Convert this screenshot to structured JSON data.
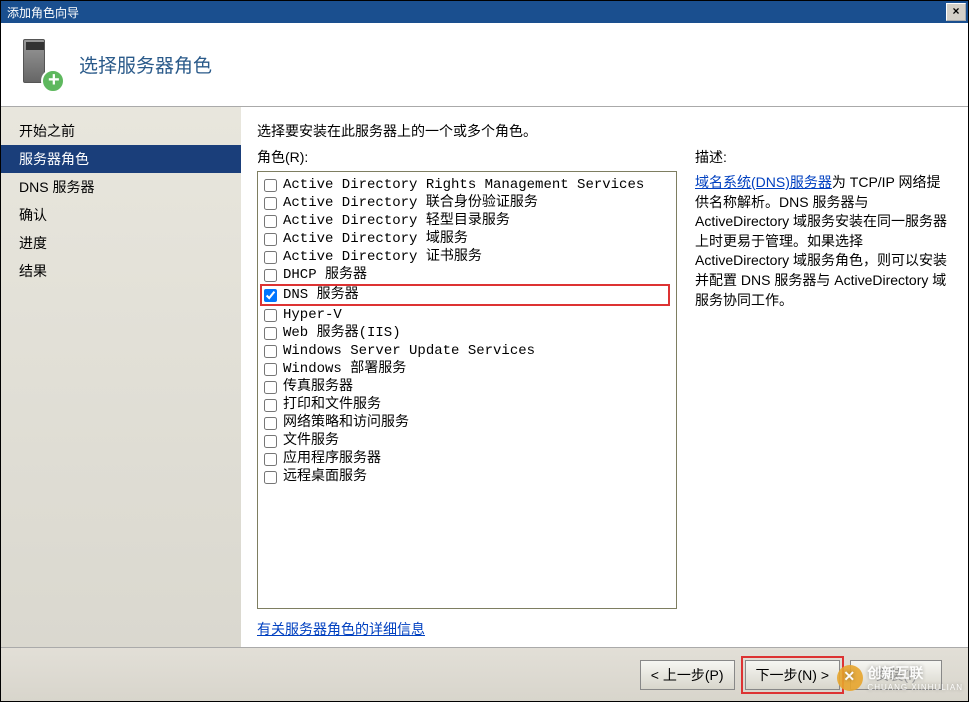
{
  "titlebar": {
    "title": "添加角色向导",
    "close": "×"
  },
  "header": {
    "title": "选择服务器角色"
  },
  "sidebar": {
    "items": [
      {
        "label": "开始之前",
        "selected": false
      },
      {
        "label": "服务器角色",
        "selected": true
      },
      {
        "label": "DNS 服务器",
        "selected": false
      },
      {
        "label": "确认",
        "selected": false
      },
      {
        "label": "进度",
        "selected": false
      },
      {
        "label": "结果",
        "selected": false
      }
    ]
  },
  "main": {
    "instruction": "选择要安装在此服务器上的一个或多个角色。",
    "roles_label": "角色(R):",
    "roles": [
      {
        "label": "Active Directory Rights Management Services",
        "checked": false,
        "highlight": false
      },
      {
        "label": "Active Directory 联合身份验证服务",
        "checked": false,
        "highlight": false
      },
      {
        "label": "Active Directory 轻型目录服务",
        "checked": false,
        "highlight": false
      },
      {
        "label": "Active Directory 域服务",
        "checked": false,
        "highlight": false
      },
      {
        "label": "Active Directory 证书服务",
        "checked": false,
        "highlight": false
      },
      {
        "label": "DHCP 服务器",
        "checked": false,
        "highlight": false
      },
      {
        "label": "DNS 服务器",
        "checked": true,
        "highlight": true
      },
      {
        "label": "Hyper-V",
        "checked": false,
        "highlight": false
      },
      {
        "label": "Web 服务器(IIS)",
        "checked": false,
        "highlight": false
      },
      {
        "label": "Windows Server Update Services",
        "checked": false,
        "highlight": false
      },
      {
        "label": "Windows 部署服务",
        "checked": false,
        "highlight": false
      },
      {
        "label": "传真服务器",
        "checked": false,
        "highlight": false
      },
      {
        "label": "打印和文件服务",
        "checked": false,
        "highlight": false
      },
      {
        "label": "网络策略和访问服务",
        "checked": false,
        "highlight": false
      },
      {
        "label": "文件服务",
        "checked": false,
        "highlight": false
      },
      {
        "label": "应用程序服务器",
        "checked": false,
        "highlight": false
      },
      {
        "label": "远程桌面服务",
        "checked": false,
        "highlight": false
      }
    ],
    "more_info": "有关服务器角色的详细信息",
    "desc_label": "描述:",
    "desc_link": "域名系统(DNS)服务器",
    "desc_rest": "为 TCP/IP 网络提供名称解析。DNS 服务器与ActiveDirectory 域服务安装在同一服务器上时更易于管理。如果选择 ActiveDirectory 域服务角色，则可以安装并配置 DNS 服务器与 ActiveDirectory 域服务协同工作。"
  },
  "footer": {
    "back": "< 上一步(P)",
    "next": "下一步(N) >",
    "install": "安装(I)"
  },
  "watermark": {
    "main": "创新互联",
    "sub": "CHUANG XINHULIAN"
  }
}
